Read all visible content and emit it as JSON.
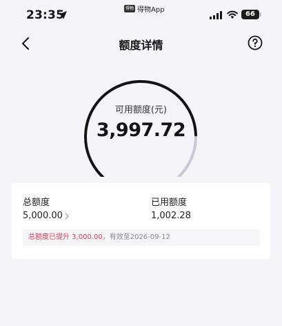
{
  "status_bar": {
    "time": "23:35",
    "back_app": "得物App",
    "back_app_badge": "得物",
    "battery": "66"
  },
  "nav": {
    "title": "额度详情"
  },
  "gauge": {
    "label": "可用额度(元)",
    "value": "3,997.72",
    "available_fraction": 0.8,
    "colors": {
      "available": "#141414",
      "used": "#c9c9d6"
    }
  },
  "summary": {
    "total_label": "总额度",
    "total_value": "5,000.00",
    "used_label": "已用额度",
    "used_value": "1,002.28"
  },
  "notice": {
    "highlight": "总额度已提升 3,000.00",
    "rest": "，有效至2026-09-12"
  },
  "colors": {
    "background": "#f5f5f9",
    "highlight": "#e0405a"
  }
}
